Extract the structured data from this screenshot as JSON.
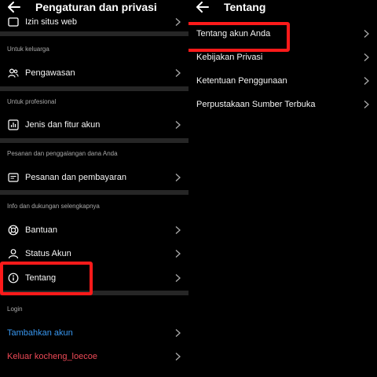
{
  "left_panel": {
    "title": "Pengaturan dan privasi",
    "top_item": "Izin situs web",
    "sections": {
      "family": "Untuk keluarga",
      "professional": "Untuk profesional",
      "orders": "Pesanan dan penggalangan dana Anda",
      "info": "Info dan dukungan selengkapnya",
      "login": "Login"
    },
    "items": {
      "supervision": "Pengawasan",
      "account_type": "Jenis dan fitur akun",
      "orders_payments": "Pesanan dan pembayaran",
      "help": "Bantuan",
      "account_status": "Status Akun",
      "about": "Tentang",
      "add_account": "Tambahkan akun",
      "logout": "Keluar kocheng_loecoe"
    }
  },
  "right_panel": {
    "title": "Tentang",
    "items": {
      "about_account": "Tentang akun Anda",
      "privacy_policy": "Kebijakan Privasi",
      "terms": "Ketentuan Penggunaan",
      "open_source": "Perpustakaan Sumber Terbuka"
    }
  },
  "colors": {
    "background": "#000000",
    "text": "#f5f5f5",
    "muted": "#a8a8a8",
    "divider": "#262626",
    "link_blue": "#3897f0",
    "logout_red": "#ed4956",
    "highlight": "#ff1a1a"
  },
  "icons": {
    "supervision": "people-icon",
    "account_type": "chart-icon",
    "orders_payments": "receipt-icon",
    "help": "lifebuoy-icon",
    "account_status": "person-icon",
    "about": "info-icon"
  }
}
